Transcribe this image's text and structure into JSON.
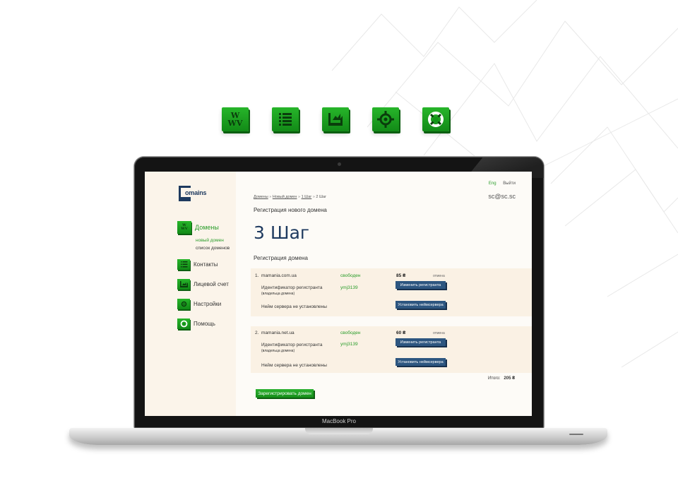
{
  "top_icons": [
    {
      "name": "www-icon",
      "letters": [
        "W",
        "W",
        "V"
      ]
    },
    {
      "name": "list-icon"
    },
    {
      "name": "account-icon"
    },
    {
      "name": "gear-icon"
    },
    {
      "name": "lifebuoy-icon"
    }
  ],
  "laptop": {
    "label": "MacBook Pro"
  },
  "logo": {
    "text": "omains"
  },
  "sidebar": {
    "items": [
      {
        "label": "Домены",
        "icon": "www-icon"
      },
      {
        "label": "Контакты",
        "icon": "list-icon"
      },
      {
        "label": "Лицевой счет",
        "icon": "account-icon"
      },
      {
        "label": "Настройки",
        "icon": "gear-icon"
      },
      {
        "label": "Помощь",
        "icon": "lifebuoy-icon"
      }
    ],
    "sub_links": [
      "новый домен",
      "список доменов"
    ]
  },
  "header": {
    "lang": "Eng",
    "logout": "Выйти",
    "user": "sc@sc.sc"
  },
  "breadcrumb": {
    "items": [
      "Домены",
      "Новый домен",
      "1 Шаг",
      "2 Шаг"
    ],
    "separator": "»"
  },
  "main": {
    "section_title": "Регистрация нового домена",
    "step_heading": "3 Шаг",
    "sub_heading": "Регистрация домена"
  },
  "domains": [
    {
      "index": "1.",
      "name": "mamania.com.ua",
      "status": "свободен",
      "price": "85 ₴",
      "cancel": "отмена",
      "registrant_label": "Идентификатор регистранта",
      "registrant_sub": "(владельца домена)",
      "registrant_id": "ymj3139",
      "change_button": "Изменить регистранта",
      "ns_label": "Нейм сервера не установлены",
      "ns_button": "Установить неймсервера"
    },
    {
      "index": "2.",
      "name": "mamania.net.ua",
      "status": "свободен",
      "price": "60 ₴",
      "cancel": "отмена",
      "registrant_label": "Идентификатор регистранта",
      "registrant_sub": "(владельца домена)",
      "registrant_id": "ymj3139",
      "change_button": "Изменить регистранта",
      "ns_label": "Нейм сервера не установлены",
      "ns_button": "Установить неймсервера"
    }
  ],
  "total": {
    "label": "Итого:",
    "value": "205 ₴"
  },
  "register_button": "Зарегистрировать домен",
  "colors": {
    "accent_green": "#2a9d2a",
    "navy": "#1e3a5f",
    "button_blue": "#2d5680",
    "sidebar_bg": "#fbf4ea",
    "block_bg": "#faf1e4"
  }
}
